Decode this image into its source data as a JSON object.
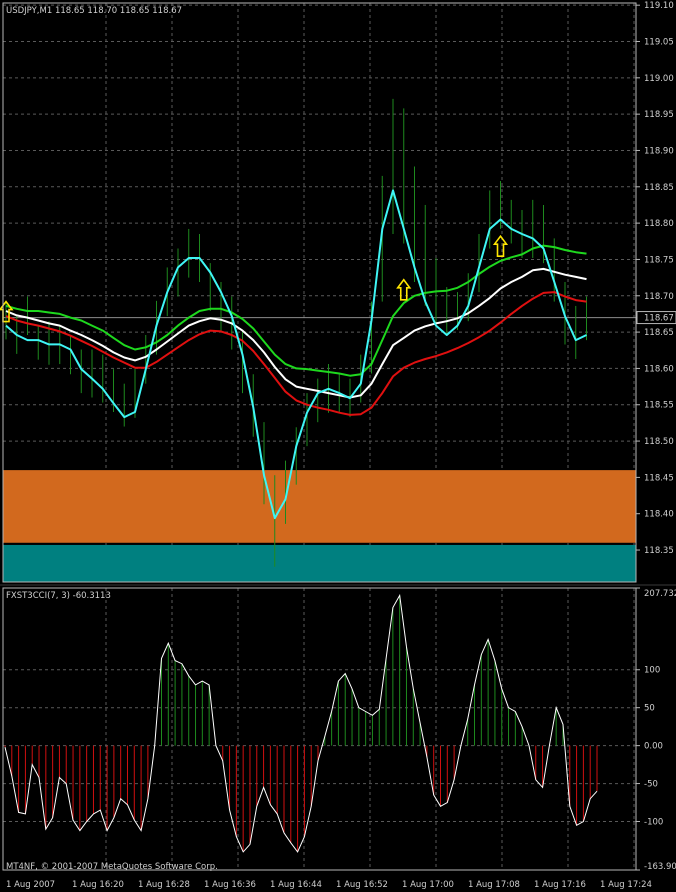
{
  "window": {
    "title": "USDJPY,M1  118.65 118.70 118.65 118.67",
    "copyright": "MT4NF, © 2001-2007 MetaQuotes Software Corp."
  },
  "colors": {
    "background": "#000000",
    "grid": "#5a5a5a",
    "frame": "#b8b8b8",
    "candles": "#1e8a1e",
    "line_fast": "#3ff5f5",
    "line_green": "#1ed81e",
    "line_white": "#ffffff",
    "line_red": "#e01010",
    "zone_upper": "#d2691e",
    "zone_lower": "#008080",
    "arrows": "#ffe600",
    "cci_up": "#1e8a1e",
    "cci_down": "#d01010",
    "cci_line": "#ffffff"
  },
  "chart_data": [
    {
      "type": "line",
      "symbol": "USDJPY,M1",
      "price_scale": [
        "119.10",
        "119.05",
        "119.00",
        "118.95",
        "118.90",
        "118.85",
        "118.80",
        "118.75",
        "118.70",
        "118.65",
        "118.60",
        "118.55",
        "118.50",
        "118.45",
        "118.40",
        "118.35"
      ],
      "ylim": [
        118.306,
        119.103
      ],
      "current_price": "118.67",
      "current_price_value": 118.67,
      "time_labels": [
        "1 Aug 2007",
        "1 Aug 16:20",
        "1 Aug 16:28",
        "1 Aug 16:36",
        "1 Aug 16:44",
        "1 Aug 16:52",
        "1 Aug 17:00",
        "1 Aug 17:08",
        "1 Aug 17:16",
        "1 Aug 17:24"
      ],
      "candles": [
        {
          "high": 118.693,
          "low": 118.64
        },
        {
          "high": 118.672,
          "low": 118.62
        },
        {
          "high": 118.699,
          "low": 118.646
        },
        {
          "high": 118.659,
          "low": 118.612
        },
        {
          "high": 118.665,
          "low": 118.605
        },
        {
          "high": 118.659,
          "low": 118.606
        },
        {
          "high": 118.646,
          "low": 118.592
        },
        {
          "high": 118.626,
          "low": 118.566
        },
        {
          "high": 118.626,
          "low": 118.56
        },
        {
          "high": 118.619,
          "low": 118.553
        },
        {
          "high": 118.599,
          "low": 118.54
        },
        {
          "high": 118.579,
          "low": 118.52
        },
        {
          "high": 118.599,
          "low": 118.532
        },
        {
          "high": 118.646,
          "low": 118.579
        },
        {
          "high": 118.693,
          "low": 118.619
        },
        {
          "high": 118.739,
          "low": 118.672
        },
        {
          "high": 118.765,
          "low": 118.699
        },
        {
          "high": 118.792,
          "low": 118.725
        },
        {
          "high": 118.785,
          "low": 118.719
        },
        {
          "high": 118.745,
          "low": 118.679
        },
        {
          "high": 118.719,
          "low": 118.652
        },
        {
          "high": 118.699,
          "low": 118.626
        },
        {
          "high": 118.652,
          "low": 118.566
        },
        {
          "high": 118.592,
          "low": 118.506
        },
        {
          "high": 118.526,
          "low": 118.413
        },
        {
          "high": 118.453,
          "low": 118.327
        },
        {
          "high": 118.473,
          "low": 118.386
        },
        {
          "high": 118.519,
          "low": 118.44
        },
        {
          "high": 118.566,
          "low": 118.493
        },
        {
          "high": 118.586,
          "low": 118.526
        },
        {
          "high": 118.606,
          "low": 118.539
        },
        {
          "high": 118.592,
          "low": 118.539
        },
        {
          "high": 118.586,
          "low": 118.533
        },
        {
          "high": 118.619,
          "low": 118.553
        },
        {
          "high": 118.692,
          "low": 118.593
        },
        {
          "high": 118.865,
          "low": 118.692
        },
        {
          "high": 118.971,
          "low": 118.785
        },
        {
          "high": 118.958,
          "low": 118.772
        },
        {
          "high": 118.878,
          "low": 118.719
        },
        {
          "high": 118.825,
          "low": 118.686
        },
        {
          "high": 118.752,
          "low": 118.659
        },
        {
          "high": 118.712,
          "low": 118.646
        },
        {
          "high": 118.705,
          "low": 118.653
        },
        {
          "high": 118.731,
          "low": 118.665
        },
        {
          "high": 118.785,
          "low": 118.705
        },
        {
          "high": 118.845,
          "low": 118.765
        },
        {
          "high": 118.858,
          "low": 118.792
        },
        {
          "high": 118.832,
          "low": 118.772
        },
        {
          "high": 118.818,
          "low": 118.752
        },
        {
          "high": 118.832,
          "low": 118.752
        },
        {
          "high": 118.825,
          "low": 118.745
        },
        {
          "high": 118.779,
          "low": 118.692
        },
        {
          "high": 118.719,
          "low": 118.633
        },
        {
          "high": 118.686,
          "low": 118.613
        },
        {
          "high": 118.699,
          "low": 118.639
        }
      ],
      "series": [
        {
          "values": [
            118.659,
            118.646,
            118.639,
            118.639,
            118.633,
            118.633,
            118.626,
            118.599,
            118.586,
            118.572,
            118.552,
            118.533,
            118.54,
            118.599,
            118.659,
            118.705,
            118.739,
            118.752,
            118.752,
            118.732,
            118.705,
            118.672,
            118.619,
            118.546,
            118.453,
            118.394,
            118.42,
            118.493,
            118.539,
            118.566,
            118.572,
            118.566,
            118.559,
            118.579,
            118.666,
            118.792,
            118.845,
            118.792,
            118.739,
            118.692,
            118.659,
            118.646,
            118.659,
            118.686,
            118.739,
            118.792,
            118.805,
            118.792,
            118.785,
            118.779,
            118.765,
            118.719,
            118.672,
            118.639,
            118.646
          ]
        },
        {
          "values": [
            118.686,
            118.682,
            118.679,
            118.679,
            118.677,
            118.675,
            118.67,
            118.666,
            118.659,
            118.652,
            118.642,
            118.632,
            118.626,
            118.629,
            118.636,
            118.646,
            118.659,
            118.67,
            118.679,
            118.682,
            118.682,
            118.677,
            118.668,
            118.655,
            118.637,
            118.619,
            118.606,
            118.6,
            118.599,
            118.597,
            118.595,
            118.593,
            118.59,
            118.592,
            118.606,
            118.639,
            118.672,
            118.69,
            118.7,
            118.704,
            118.706,
            118.707,
            118.711,
            118.719,
            118.73,
            118.74,
            118.748,
            118.753,
            118.757,
            118.765,
            118.769,
            118.767,
            118.763,
            118.76,
            118.758
          ]
        },
        {
          "values": [
            118.679,
            118.673,
            118.67,
            118.666,
            118.662,
            118.659,
            118.652,
            118.646,
            118.639,
            118.631,
            118.622,
            118.615,
            118.611,
            118.616,
            118.626,
            118.637,
            118.648,
            118.659,
            118.665,
            118.669,
            118.667,
            118.662,
            118.652,
            118.639,
            118.622,
            118.602,
            118.585,
            118.575,
            118.572,
            118.569,
            118.566,
            118.563,
            118.56,
            118.563,
            118.579,
            118.606,
            118.632,
            118.642,
            118.652,
            118.658,
            118.662,
            118.665,
            118.669,
            118.676,
            118.686,
            118.697,
            118.71,
            118.719,
            118.726,
            118.735,
            118.737,
            118.733,
            118.729,
            118.726,
            118.723
          ]
        },
        {
          "values": [
            118.672,
            118.666,
            118.662,
            118.659,
            118.655,
            118.651,
            118.645,
            118.638,
            118.631,
            118.623,
            118.615,
            118.608,
            118.601,
            118.601,
            118.609,
            118.619,
            118.629,
            118.639,
            118.647,
            118.652,
            118.651,
            118.646,
            118.638,
            118.624,
            118.606,
            118.587,
            118.568,
            118.556,
            118.55,
            118.546,
            118.543,
            118.539,
            118.536,
            118.537,
            118.546,
            118.566,
            118.589,
            118.601,
            118.608,
            118.613,
            118.617,
            118.622,
            118.628,
            118.635,
            118.643,
            118.652,
            118.663,
            118.675,
            118.686,
            118.696,
            118.704,
            118.705,
            118.699,
            118.694,
            118.692
          ]
        }
      ],
      "zones": [
        {
          "from": 118.36,
          "to": 118.46
        },
        {
          "from": 118.306,
          "to": 118.357
        }
      ],
      "arrows": [
        {
          "bar": 0,
          "price": 118.67
        },
        {
          "bar": 37,
          "price": 118.7
        },
        {
          "bar": 46,
          "price": 118.76
        }
      ]
    },
    {
      "type": "bar",
      "label": "FXST3CCI(7, 3) -60.3113",
      "scale_labels": [
        "207.7323",
        "100",
        "50",
        "0.00",
        "-50",
        "-100",
        "-163.902"
      ],
      "ylim": [
        -163.902,
        207.7323
      ],
      "values": [
        -2,
        -40,
        -88,
        -90,
        -25,
        -42,
        -110,
        -95,
        -42,
        -50,
        -98,
        -112,
        -100,
        -90,
        -85,
        -112,
        -95,
        -70,
        -78,
        -98,
        -112,
        -70,
        0,
        115,
        135,
        112,
        108,
        92,
        80,
        85,
        80,
        0,
        -20,
        -85,
        -120,
        -140,
        -130,
        -80,
        -55,
        -78,
        -90,
        -115,
        -128,
        -140,
        -120,
        -80,
        -20,
        12,
        45,
        85,
        95,
        75,
        50,
        45,
        40,
        48,
        115,
        182,
        198,
        130,
        75,
        30,
        -15,
        -65,
        -80,
        -75,
        -45,
        0,
        35,
        80,
        120,
        140,
        112,
        75,
        50,
        45,
        25,
        0,
        -45,
        -55,
        0,
        50,
        28,
        -80,
        -105,
        -100,
        -70,
        -60
      ]
    }
  ]
}
